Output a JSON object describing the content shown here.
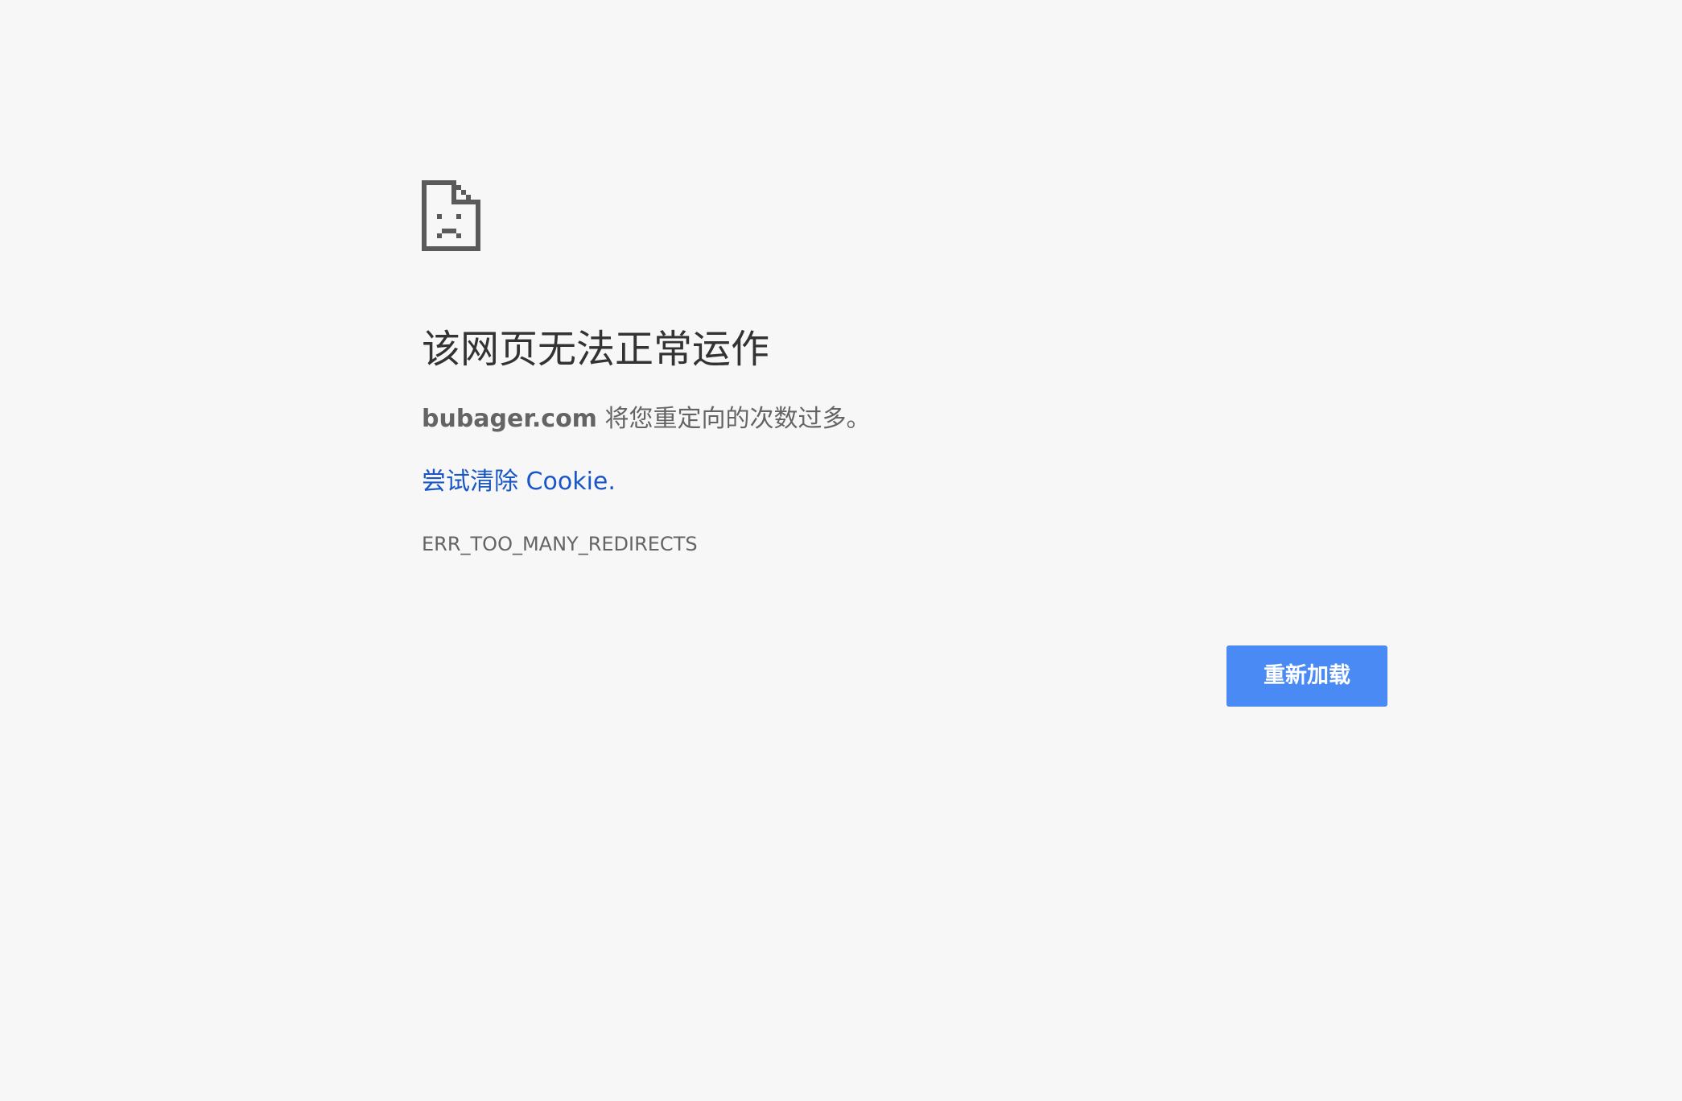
{
  "page": {
    "background": "#f7f7f7"
  },
  "icon": {
    "name": "sad-page-icon",
    "color": "#5a5a5a"
  },
  "heading": "该网页无法正常运作",
  "summary": {
    "host": "bubager.com",
    "message": " 将您重定向的次数过多。"
  },
  "suggestion": {
    "link_text": "尝试清除 Cookie",
    "trailing": "."
  },
  "error_code": "ERR_TOO_MANY_REDIRECTS",
  "buttons": {
    "reload_label": "重新加载",
    "reload_color": "#4a8af4"
  },
  "colors": {
    "heading": "#333333",
    "body_text": "#646464",
    "link": "#1a56c5"
  }
}
